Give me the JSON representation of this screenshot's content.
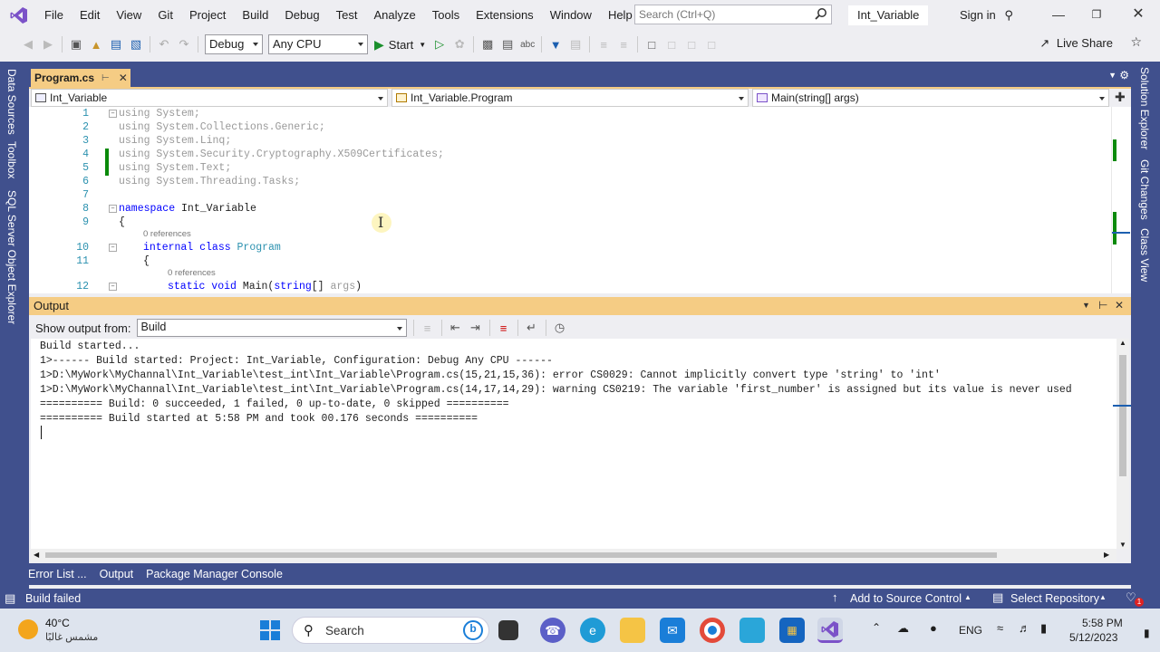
{
  "titlebar": {
    "menu": [
      "File",
      "Edit",
      "View",
      "Git",
      "Project",
      "Build",
      "Debug",
      "Test",
      "Analyze",
      "Tools",
      "Extensions",
      "Window",
      "Help"
    ],
    "search_placeholder": "Search (Ctrl+Q)",
    "solution_name": "Int_Variable",
    "sign_in": "Sign in"
  },
  "toolbar": {
    "configuration": "Debug",
    "platform": "Any CPU",
    "start_label": "Start",
    "live_share": "Live Share"
  },
  "left_tabs": [
    "Data Sources",
    "Toolbox",
    "SQL Server Object Explorer"
  ],
  "right_tabs": [
    "Solution Explorer",
    "Git Changes",
    "Class View"
  ],
  "document": {
    "tab_label": "Program.cs",
    "nav_project": "Int_Variable",
    "nav_class": "Int_Variable.Program",
    "nav_member": "Main(string[] args)",
    "line_numbers": [
      "1",
      "2",
      "3",
      "4",
      "5",
      "6",
      "7",
      "8",
      "9",
      "10",
      "11",
      "12"
    ],
    "code": {
      "l1_kw": "using",
      "l1_rest": " System;",
      "l2_kw": "using",
      "l2_rest": " System.Collections.Generic;",
      "l3_kw": "using",
      "l3_rest": " System.Linq;",
      "l4_kw": "using",
      "l4_rest": " System.Security.Cryptography.X509Certificates;",
      "l5_kw": "using",
      "l5_rest": " System.Text;",
      "l6_kw": "using",
      "l6_rest": " System.Threading.Tasks;",
      "l8_kw": "namespace",
      "l8_rest": " Int_Variable",
      "l9": "{",
      "refs_class": "0 references",
      "l10_kw": "internal class",
      "l10_type": " Program",
      "l11": "{",
      "refs_main": "0 references",
      "l12_kw": "static void",
      "l12_name": " Main(",
      "l12_kw2": "string",
      "l12_args": "[] ",
      "l12_param": "args",
      "l12_end": ")"
    }
  },
  "output": {
    "title": "Output",
    "show_from_label": "Show output from:",
    "show_from_value": "Build",
    "lines": [
      "Build started...",
      "1>------ Build started: Project: Int_Variable, Configuration: Debug Any CPU ------",
      "1>D:\\MyWork\\MyChannal\\Int_Variable\\test_int\\Int_Variable\\Program.cs(15,21,15,36): error CS0029: Cannot implicitly convert type 'string' to 'int'",
      "1>D:\\MyWork\\MyChannal\\Int_Variable\\test_int\\Int_Variable\\Program.cs(14,17,14,29): warning CS0219: The variable 'first_number' is assigned but its value is never used",
      "========== Build: 0 succeeded, 1 failed, 0 up-to-date, 0 skipped ==========",
      "========== Build started at 5:58 PM and took 00.176 seconds =========="
    ]
  },
  "bottom_tabs": [
    "Error List ...",
    "Output",
    "Package Manager Console"
  ],
  "statusbar": {
    "status": "Build failed",
    "source_control": "Add to Source Control",
    "repository": "Select Repository",
    "notification_count": "1"
  },
  "taskbar": {
    "weather_temp": "40°C",
    "weather_desc": "مشمس غالبًا",
    "search_label": "Search",
    "language": "ENG",
    "time": "5:58 PM",
    "date": "5/12/2023"
  },
  "colors": {
    "accent_blue": "#40508D",
    "active_tab": "#F5CC84",
    "vs_purple": "#7B52C8"
  }
}
